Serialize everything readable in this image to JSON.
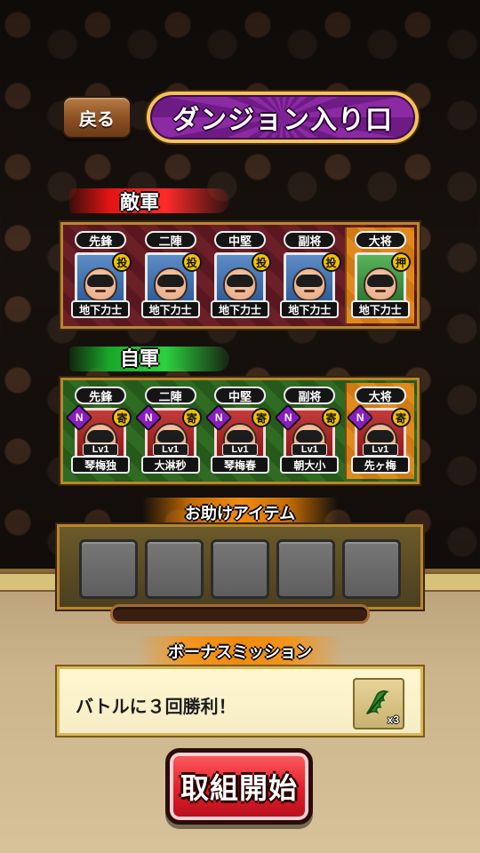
{
  "header": {
    "back_label": "戻る",
    "title": "ダンジョン入り口"
  },
  "enemy": {
    "label": "敵軍",
    "slots": [
      {
        "rank": "先鋒",
        "name": "地下力士",
        "technique": "投",
        "card_color": "blue"
      },
      {
        "rank": "二陣",
        "name": "地下力士",
        "technique": "投",
        "card_color": "blue"
      },
      {
        "rank": "中堅",
        "name": "地下力士",
        "technique": "投",
        "card_color": "blue"
      },
      {
        "rank": "副将",
        "name": "地下力士",
        "technique": "投",
        "card_color": "blue"
      },
      {
        "rank": "大将",
        "name": "地下力士",
        "technique": "押",
        "card_color": "green"
      }
    ]
  },
  "ally": {
    "label": "自軍",
    "slots": [
      {
        "rank": "先鋒",
        "name": "琴梅独",
        "rarity": "N",
        "technique": "寄",
        "level": "Lv1",
        "card_color": "red"
      },
      {
        "rank": "二陣",
        "name": "大淋秒",
        "rarity": "N",
        "technique": "寄",
        "level": "Lv1",
        "card_color": "red"
      },
      {
        "rank": "中堅",
        "name": "琴梅春",
        "rarity": "N",
        "technique": "寄",
        "level": "Lv1",
        "card_color": "red"
      },
      {
        "rank": "副将",
        "name": "朝大小",
        "rarity": "N",
        "technique": "寄",
        "level": "Lv1",
        "card_color": "red"
      },
      {
        "rank": "大将",
        "name": "先ヶ梅",
        "rarity": "N",
        "technique": "寄",
        "level": "Lv1",
        "card_color": "red"
      }
    ]
  },
  "help_items": {
    "title": "お助けアイテム",
    "slots_count": 5
  },
  "bonus_mission": {
    "title": "ボーナスミッション",
    "text": "バトルに３回勝利！",
    "reward_icon": "herb-icon",
    "reward_qty": "x3"
  },
  "start_button": {
    "label": "取組開始"
  }
}
